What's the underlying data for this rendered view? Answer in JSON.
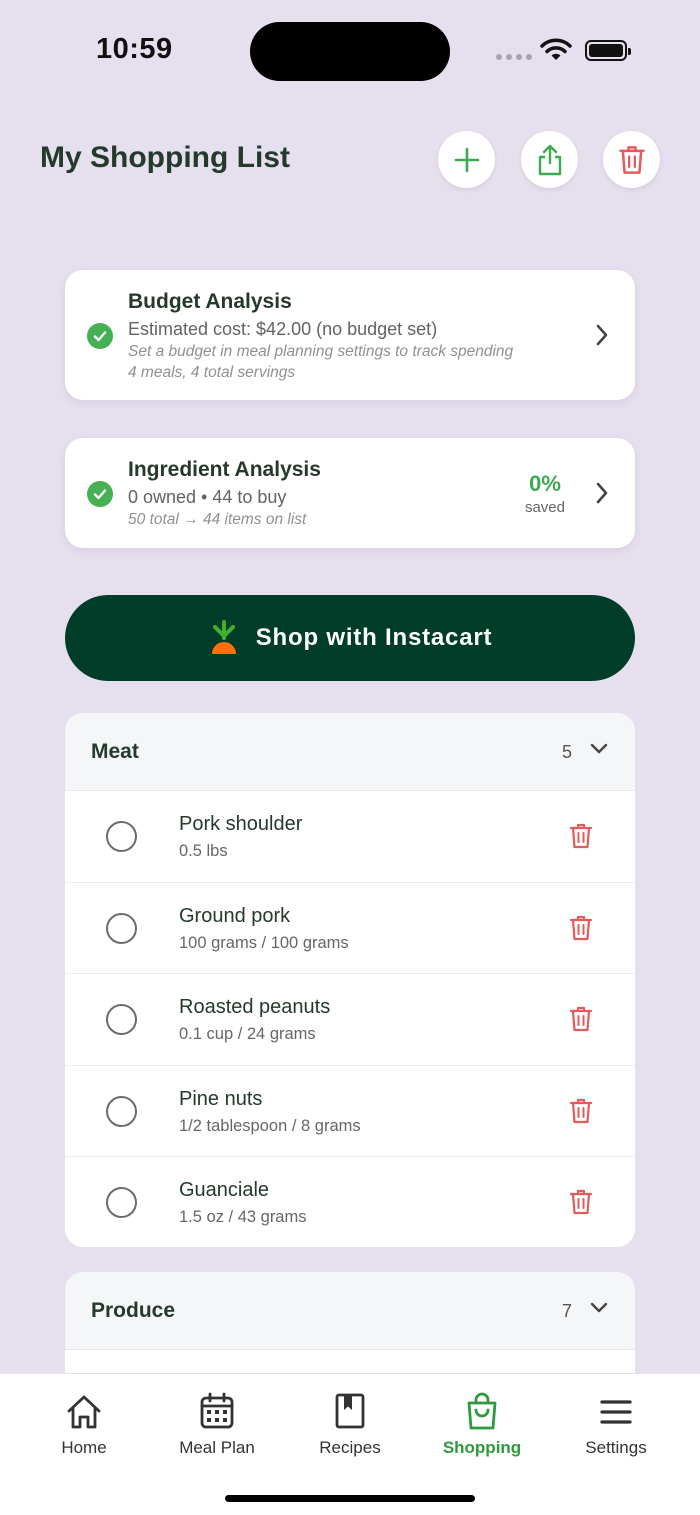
{
  "status_bar": {
    "time": "10:59"
  },
  "header": {
    "title": "My Shopping List"
  },
  "budget_card": {
    "title": "Budget Analysis",
    "estimate": "Estimated cost: $42.00 (no budget set)",
    "hint": "Set a budget in meal planning settings to track spending",
    "summary": "4 meals, 4 total servings"
  },
  "ingredient_card": {
    "title": "Ingredient Analysis",
    "summary": "0 owned • 44 to buy",
    "detail": "50 total → 44 items on list",
    "saved_value": "0%",
    "saved_label": "saved"
  },
  "instacart": {
    "label": "Shop with Instacart"
  },
  "sections": [
    {
      "name": "Meat",
      "count": "5",
      "items": [
        {
          "name": "Pork shoulder",
          "qty": "0.5 lbs"
        },
        {
          "name": "Ground pork",
          "qty": "100 grams / 100 grams"
        },
        {
          "name": "Roasted peanuts",
          "qty": "0.1 cup / 24 grams"
        },
        {
          "name": "Pine nuts",
          "qty": "1/2 tablespoon / 8 grams"
        },
        {
          "name": "Guanciale",
          "qty": "1.5 oz / 43 grams"
        }
      ]
    },
    {
      "name": "Produce",
      "count": "7",
      "items": []
    }
  ],
  "tabbar": {
    "tabs": [
      {
        "label": "Home",
        "icon": "home-icon"
      },
      {
        "label": "Meal Plan",
        "icon": "calendar-icon"
      },
      {
        "label": "Recipes",
        "icon": "book-icon"
      },
      {
        "label": "Shopping",
        "icon": "shopping-bag-icon",
        "active": true
      },
      {
        "label": "Settings",
        "icon": "menu-icon"
      }
    ]
  },
  "colors": {
    "background": "#e6dfee",
    "accent_green": "#3eaa4e",
    "instacart_green": "#003d29",
    "delete_red": "#e35b5b",
    "text_dark": "#25392c"
  }
}
